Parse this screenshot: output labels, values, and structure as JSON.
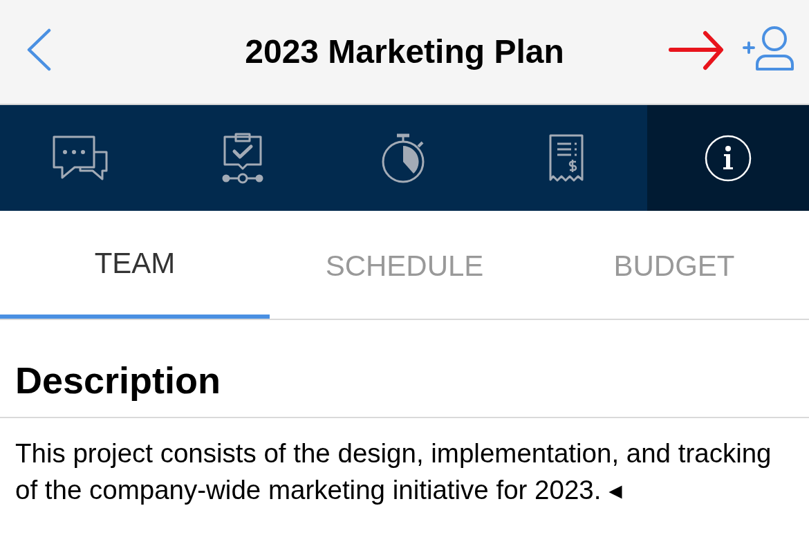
{
  "header": {
    "title": "2023 Marketing Plan"
  },
  "icon_tabs": [
    {
      "kind": "chat",
      "selected": false
    },
    {
      "kind": "tasks",
      "selected": false
    },
    {
      "kind": "timer",
      "selected": false
    },
    {
      "kind": "receipt",
      "selected": false
    },
    {
      "kind": "info",
      "selected": true
    }
  ],
  "section_tabs": [
    {
      "label": "TEAM",
      "selected": true
    },
    {
      "label": "SCHEDULE",
      "selected": false
    },
    {
      "label": "BUDGET",
      "selected": false
    }
  ],
  "description": {
    "heading": "Description",
    "text": "This project consists of the design, implementation, and tracking of the company-wide marketing initiative for 2023. ◂"
  }
}
